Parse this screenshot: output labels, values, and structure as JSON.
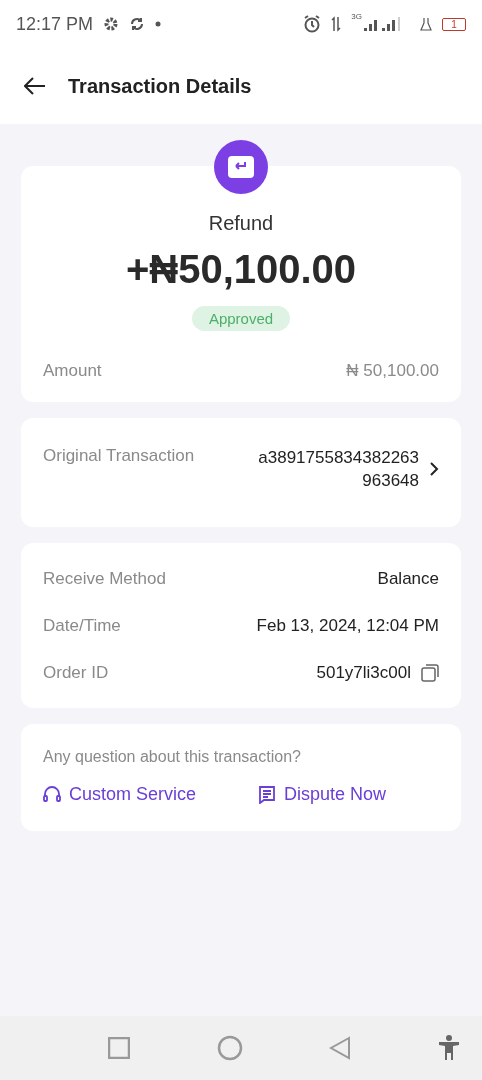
{
  "status_bar": {
    "time": "12:17 PM",
    "network": "3G",
    "battery": "1"
  },
  "header": {
    "title": "Transaction Details"
  },
  "summary": {
    "type": "Refund",
    "amount": "+₦50,100.00",
    "status": "Approved",
    "amount_label": "Amount",
    "amount_value": "₦ 50,100.00"
  },
  "original_transaction": {
    "label": "Original Transaction",
    "value": "a3891755834382263963648"
  },
  "details": [
    {
      "label": "Receive Method",
      "value": "Balance",
      "kind": "plain"
    },
    {
      "label": "Date/Time",
      "value": "Feb 13, 2024, 12:04 PM",
      "kind": "plain"
    },
    {
      "label": "Order ID",
      "value": "501y7li3c00l",
      "kind": "copy"
    }
  ],
  "help": {
    "question": "Any question about this transaction?",
    "actions": [
      {
        "label": "Custom Service",
        "kind": "service"
      },
      {
        "label": "Dispute Now",
        "kind": "dispute"
      }
    ]
  }
}
